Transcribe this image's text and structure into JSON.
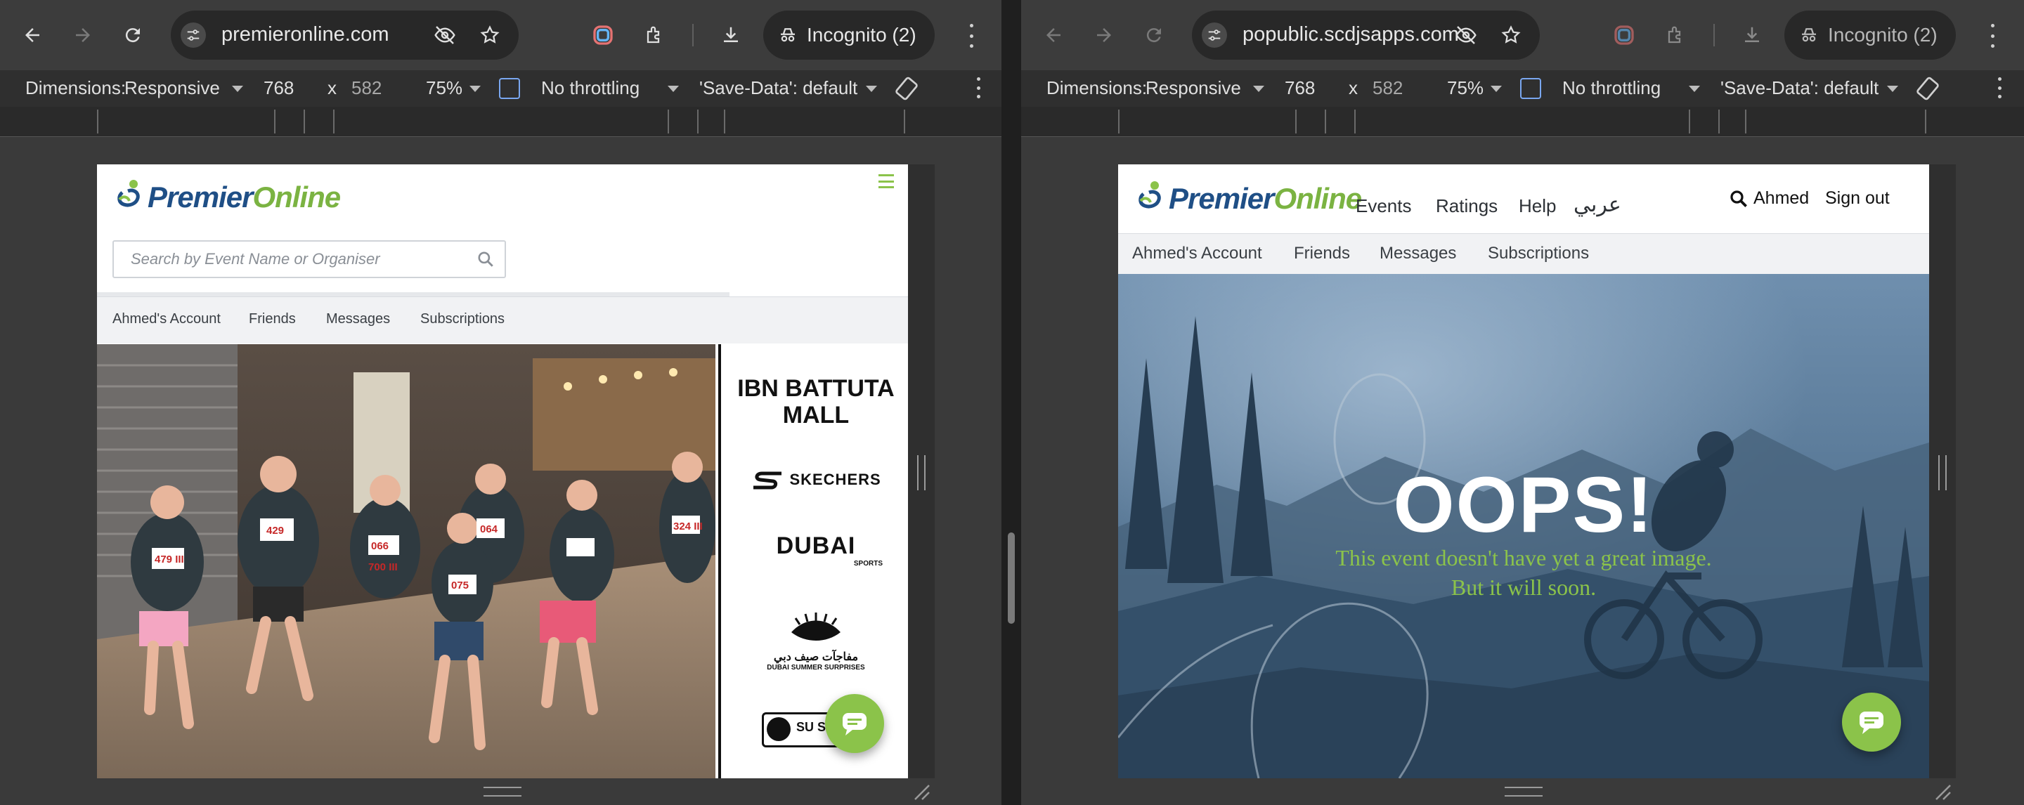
{
  "left": {
    "url": "premieronline.com",
    "incognito": "Incognito (2)",
    "devtools": {
      "dimensions_label": "Dimensions:",
      "device": "Responsive",
      "width": "768",
      "times": "x",
      "height": "582",
      "zoom": "75%",
      "throttling": "No throttling",
      "save_data": "'Save-Data': default"
    },
    "page": {
      "logo_part1": "Premier",
      "logo_part2": "Online",
      "search_placeholder": "Search by Event Name or Organiser",
      "subnav": [
        "Ahmed's Account",
        "Friends",
        "Messages",
        "Subscriptions"
      ],
      "sponsors": {
        "s1_line1": "IBN BATTUTA",
        "s1_line2": "MALL",
        "s2": "SKECHERS",
        "s3_main": "DUBAI",
        "s3_sub": "SPORTS",
        "s4_line1": "مفاجآت صيف دبي",
        "s4_line2": "DUBAI SUMMER SURPRISES",
        "s5": "SU SP"
      },
      "bibs": [
        "479 III",
        "429",
        "066",
        "700 III",
        "075",
        "064",
        "324 III"
      ]
    }
  },
  "right": {
    "url": "popublic.scdjsapps.com",
    "incognito": "Incognito (2)",
    "devtools": {
      "dimensions_label": "Dimensions:",
      "device": "Responsive",
      "width": "768",
      "times": "x",
      "height": "582",
      "zoom": "75%",
      "throttling": "No throttling",
      "save_data": "'Save-Data': default"
    },
    "page": {
      "logo_part1": "Premier",
      "logo_part2": "Online",
      "nav": [
        "Events",
        "Ratings",
        "Help",
        "عربي"
      ],
      "user": "Ahmed",
      "signout": "Sign out",
      "subnav": [
        "Ahmed's Account",
        "Friends",
        "Messages",
        "Subscriptions"
      ],
      "oops": "OOPS!",
      "msg_line1": "This event doesn't have yet a great image.",
      "msg_line2": "But it will soon."
    }
  },
  "colors": {
    "brand_blue": "#1f4f86",
    "brand_green": "#8bc34a",
    "chrome_dark": "#3c3c3c"
  },
  "icons": [
    "back-icon",
    "forward-icon",
    "reload-icon",
    "tune-icon",
    "eye-off-icon",
    "star-icon",
    "chrome-apps-icon",
    "extensions-icon",
    "download-icon",
    "incognito-icon",
    "more-icon",
    "rotate-icon",
    "search-icon",
    "hamburger-icon",
    "chat-icon"
  ]
}
